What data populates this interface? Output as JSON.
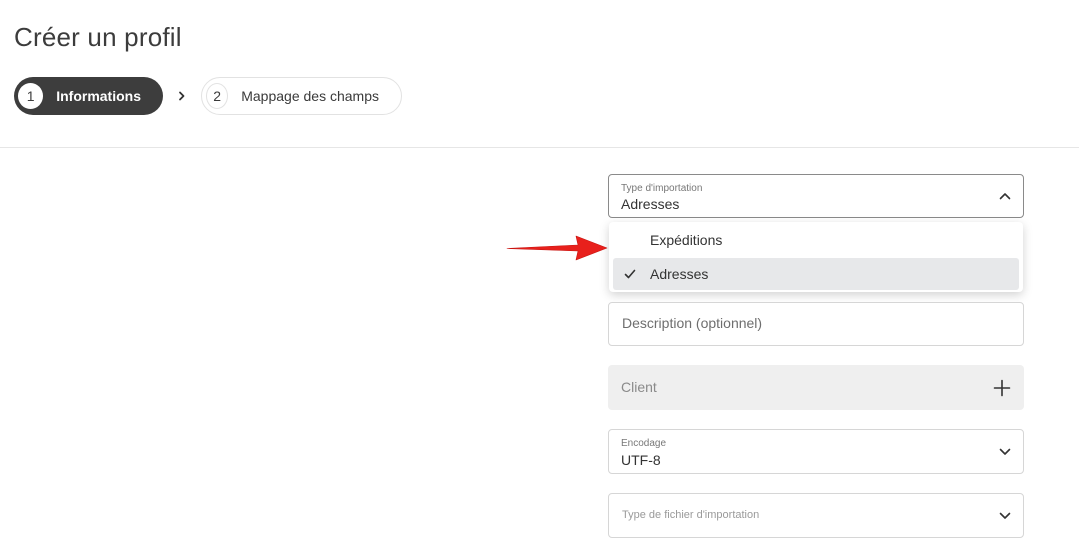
{
  "page": {
    "title": "Créer un profil"
  },
  "stepper": {
    "steps": [
      {
        "number": "1",
        "label": "Informations",
        "state": "active"
      },
      {
        "number": "2",
        "label": "Mappage des champs",
        "state": "inactive"
      }
    ]
  },
  "form": {
    "import_type": {
      "label": "Type d'importation",
      "value": "Adresses",
      "expanded": true,
      "options": [
        {
          "label": "Expéditions",
          "selected": false
        },
        {
          "label": "Adresses",
          "selected": true
        }
      ]
    },
    "description": {
      "placeholder": "Description (optionnel)"
    },
    "client": {
      "placeholder": "Client"
    },
    "encoding": {
      "label": "Encodage",
      "value": "UTF-8"
    },
    "file_type": {
      "placeholder": "Type de fichier d'importation"
    }
  },
  "colors": {
    "active_step": "#3d3d3d",
    "annotation_arrow": "#e8201c",
    "selected_option_bg": "#e7e8ea",
    "disabled_field_bg": "#efefef"
  },
  "icons": {
    "step_separator": "chevron-right-icon",
    "import_type_toggle": "chevron-up-icon",
    "selected_option": "check-icon",
    "client_action": "plus-icon",
    "dropdown_toggle": "chevron-down-icon",
    "annotation": "red-arrow-icon"
  }
}
